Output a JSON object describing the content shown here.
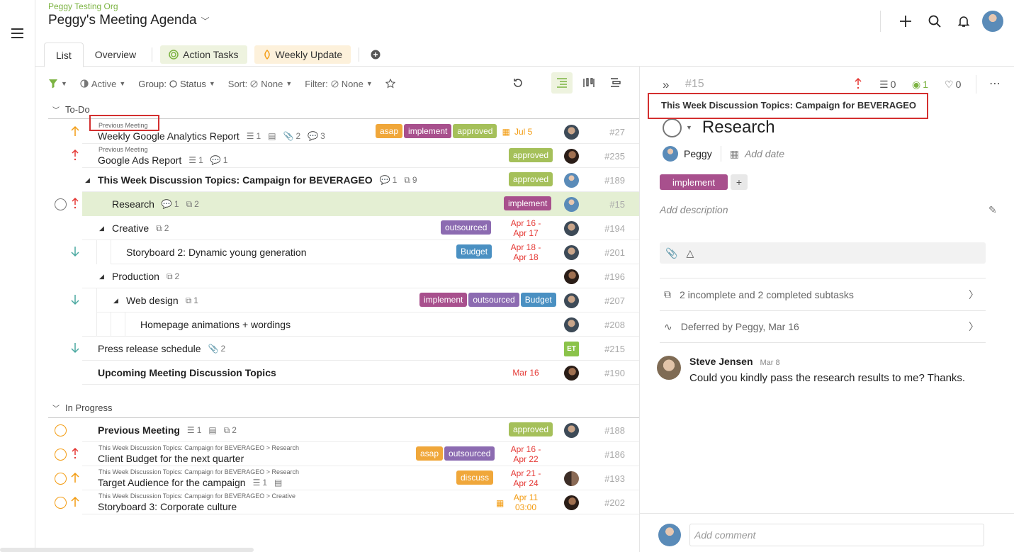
{
  "org": "Peggy Testing Org",
  "page_title": "Peggy's Meeting Agenda",
  "tabs": [
    {
      "label": "List"
    },
    {
      "label": "Overview"
    },
    {
      "label": "Action Tasks"
    },
    {
      "label": "Weekly Update"
    }
  ],
  "toolbar": {
    "active": "Active",
    "group_key": "Group:",
    "group_val": "Status",
    "sort_key": "Sort:",
    "sort_val": "None",
    "filter_key": "Filter:",
    "filter_val": "None"
  },
  "groups": {
    "todo": "To-Do",
    "inprogress": "In Progress"
  },
  "rows": {
    "r1": {
      "crumb": "Previous Meeting",
      "title": "Weekly Google Analytics Report",
      "m1": "1",
      "m3": "2",
      "m4": "3",
      "tags": [
        "asap",
        "implement",
        "approved"
      ],
      "date": "Jul 5",
      "num": "#27"
    },
    "r2": {
      "crumb": "Previous Meeting",
      "title": "Google Ads Report",
      "m1": "1",
      "m3": "1",
      "tags": [
        "approved"
      ],
      "num": "#235"
    },
    "r3": {
      "title": "This Week Discussion Topics: Campaign for BEVERAGEO",
      "m1": "1",
      "m2": "9",
      "tags": [
        "approved"
      ],
      "num": "#189"
    },
    "r4": {
      "title": "Research",
      "m1": "1",
      "m2": "2",
      "tags": [
        "implement"
      ],
      "num": "#15"
    },
    "r5": {
      "title": "Creative",
      "m2": "2",
      "tags": [
        "outsourced"
      ],
      "date1": "Apr 16 -",
      "date2": "Apr 17",
      "num": "#194"
    },
    "r6": {
      "title": "Storyboard 2: Dynamic young generation",
      "tags": [
        "Budget"
      ],
      "date1": "Apr 18 -",
      "date2": "Apr 18",
      "num": "#201"
    },
    "r7": {
      "title": "Production",
      "m2": "2",
      "num": "#196"
    },
    "r8": {
      "title": "Web design",
      "m2": "1",
      "tags": [
        "implement",
        "outsourced",
        "Budget"
      ],
      "num": "#207"
    },
    "r9": {
      "title": "Homepage animations + wordings",
      "num": "#208"
    },
    "r10": {
      "title": "Press release schedule",
      "m3": "2",
      "avatar": "ET",
      "num": "#215"
    },
    "r11": {
      "title": "Upcoming Meeting Discussion Topics",
      "date": "Mar 16",
      "num": "#190"
    },
    "p1": {
      "title": "Previous Meeting",
      "m1": "1",
      "m2": "2",
      "tags": [
        "approved"
      ],
      "num": "#188"
    },
    "p2": {
      "crumb": "This Week Discussion Topics: Campaign for BEVERAGEO > Research",
      "title": "Client Budget for the next quarter",
      "tags": [
        "asap",
        "outsourced"
      ],
      "date1": "Apr 16 -",
      "date2": "Apr 22",
      "num": "#186"
    },
    "p3": {
      "crumb": "This Week Discussion Topics: Campaign for BEVERAGEO > Research",
      "title": "Target Audience for the campaign",
      "m1": "1",
      "tags": [
        "discuss"
      ],
      "date1": "Apr 21 -",
      "date2": "Apr 24",
      "num": "#193"
    },
    "p4": {
      "crumb": "This Week Discussion Topics: Campaign for BEVERAGEO > Creative",
      "title": "Storyboard 3: Corporate culture",
      "date1": "Apr 11",
      "date2": "03:00",
      "num": "#202"
    }
  },
  "tag_colors": {
    "asap": "#f0a73a",
    "implement": "#a8508d",
    "approved": "#a5c05a",
    "outsourced": "#8c6bb1",
    "Budget": "#4a90c2",
    "discuss": "#f0a73a"
  },
  "panel": {
    "id": "#15",
    "subtasks_count": "0",
    "watchers": "1",
    "likes": "0",
    "parent": "This Week Discussion Topics: Campaign for BEVERAGEO",
    "title": "Research",
    "assignee": "Peggy",
    "add_date": "Add date",
    "tag": "implement",
    "add_description": "Add description",
    "subtasks": "2 incomplete and 2 completed subtasks",
    "deferred": "Deferred by Peggy, Mar 16",
    "comment_author": "Steve Jensen",
    "comment_date": "Mar 8",
    "comment_text": "Could you kindly pass the research results to me? Thanks.",
    "add_comment": "Add comment"
  }
}
